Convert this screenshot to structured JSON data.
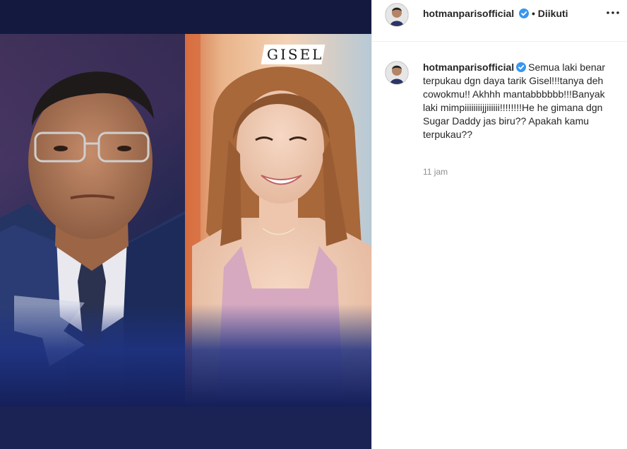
{
  "post": {
    "overlay_label": "GISEL"
  },
  "header": {
    "username": "hotmanparisofficial",
    "follow_state": "• Diikuti"
  },
  "caption": {
    "username": "hotmanparisofficial",
    "text": "Semua laki benar terpukau dgn daya tarik Gisel!!!tanya deh cowokmu!! Akhhh mantabbbbbb!!!Banyak laki mimpiiiiiiiijjiiiiii!!!!!!!!He he gimana dgn Sugar Daddy jas biru?? Apakah kamu terpukau??",
    "timestamp": "11 jam"
  },
  "colors": {
    "verified_badge": "#3897f0",
    "media_background": "#0f1535",
    "muted_text": "#8e8e8e"
  },
  "icons": [
    "verified-badge-icon",
    "more-options-icon"
  ]
}
